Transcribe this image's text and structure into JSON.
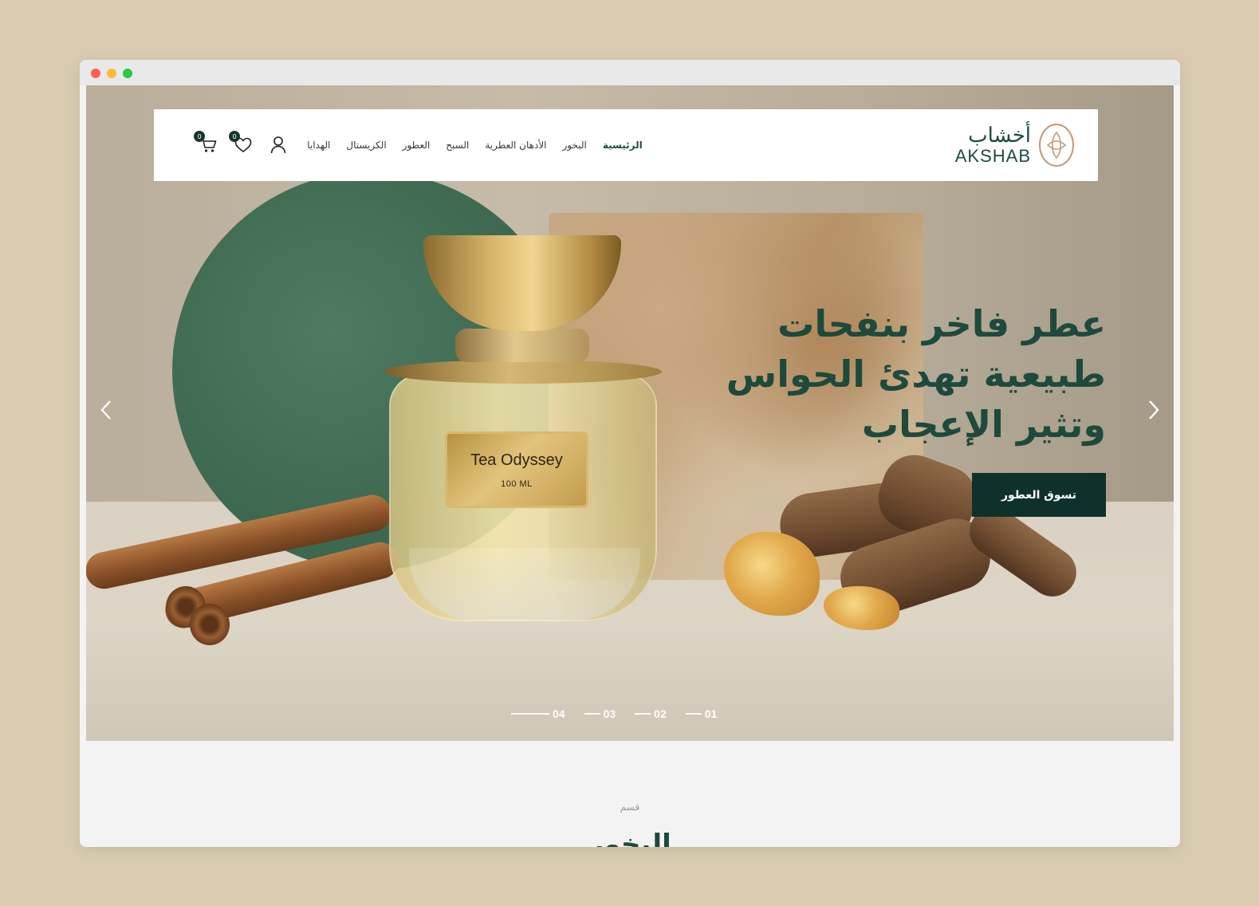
{
  "header": {
    "logo_ar": "أخشاب",
    "logo_en": "AKSHAB",
    "nav": [
      {
        "label": "الرئيسية",
        "active": true
      },
      {
        "label": "البخور",
        "active": false
      },
      {
        "label": "الأدهان العطرية",
        "active": false
      },
      {
        "label": "السبح",
        "active": false
      },
      {
        "label": "العطور",
        "active": false
      },
      {
        "label": "الكريستال",
        "active": false
      },
      {
        "label": "الهدايا",
        "active": false
      }
    ],
    "wishlist_count": "0",
    "cart_count": "0"
  },
  "hero": {
    "headline": "عطر فاخر بنفحات طبيعية تهدئ الحواس وتثير الإعجاب",
    "cta_label": "تسوق العطور",
    "bottle_name": "Tea Odyssey",
    "bottle_size": "100 ML",
    "slides": [
      "01",
      "02",
      "03",
      "04"
    ]
  },
  "section": {
    "kicker": "قسم",
    "title": "البخور"
  },
  "colors": {
    "brand_dark": "#0f312c",
    "brand_green": "#1d4a3c",
    "page_bg": "#d8cbb0"
  }
}
